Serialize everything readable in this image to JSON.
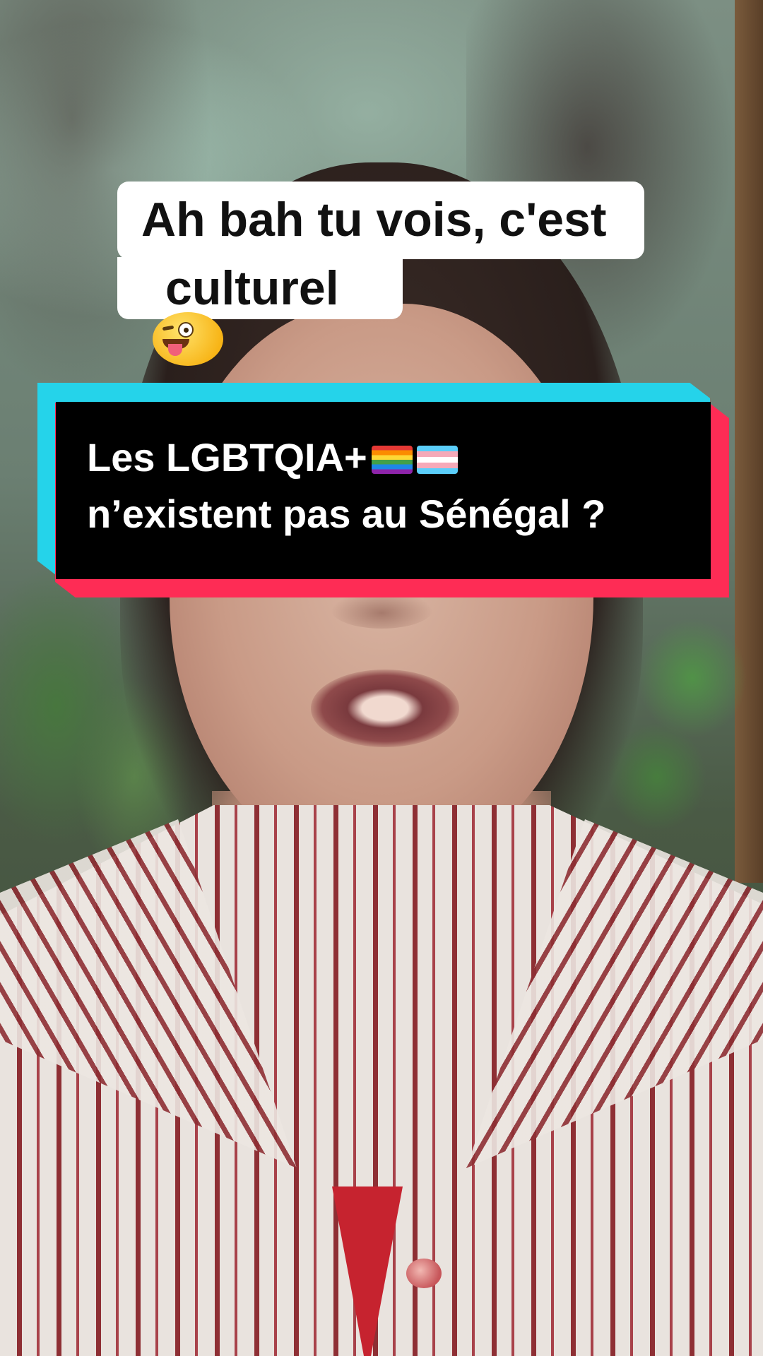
{
  "caption": {
    "line1": "Ah bah tu vois, c'est",
    "line2": "culturel",
    "emoji": "winking-face-with-tongue"
  },
  "title_banner": {
    "line1": "Les LGBTQIA+",
    "line1_flags": [
      "rainbow-flag",
      "transgender-flag"
    ],
    "line2": "n’existent pas au Sénégal ?",
    "colors": {
      "background": "#000000",
      "shadow_left": "#25d3ea",
      "shadow_right": "#fe2c55",
      "text": "#ffffff"
    }
  },
  "caption_colors": {
    "background": "#ffffff",
    "text": "#111111"
  }
}
